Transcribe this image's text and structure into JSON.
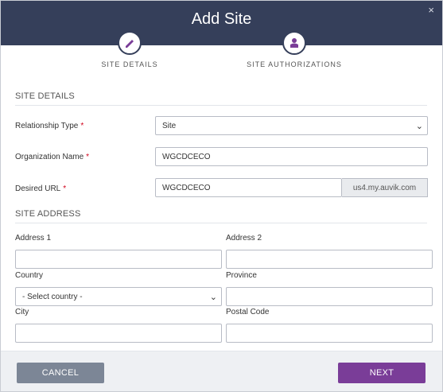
{
  "dialog": {
    "title": "Add Site",
    "close_label": "×"
  },
  "steps": [
    {
      "label": "SITE DETAILS",
      "icon": "pencil-icon"
    },
    {
      "label": "SITE AUTHORIZATIONS",
      "icon": "user-lock-icon"
    }
  ],
  "site_details": {
    "section_title": "SITE DETAILS",
    "relationship_type": {
      "label": "Relationship Type",
      "required_mark": "*",
      "value": "Site"
    },
    "organization_name": {
      "label": "Organization Name",
      "required_mark": "*",
      "value": "WGCDCECO"
    },
    "desired_url": {
      "label": "Desired URL",
      "required_mark": "*",
      "value": "WGCDCECO",
      "suffix": "us4.my.auvik.com"
    }
  },
  "site_address": {
    "section_title": "SITE ADDRESS",
    "address1": {
      "label": "Address 1",
      "value": ""
    },
    "address2": {
      "label": "Address 2",
      "value": ""
    },
    "country": {
      "label": "Country",
      "value": "- Select country -"
    },
    "province": {
      "label": "Province",
      "value": ""
    },
    "city": {
      "label": "City",
      "value": ""
    },
    "postal_code": {
      "label": "Postal Code",
      "value": ""
    }
  },
  "footer": {
    "cancel_label": "CANCEL",
    "next_label": "NEXT"
  },
  "colors": {
    "header": "#353f5a",
    "primary": "#7a3d98",
    "secondary": "#7c8696",
    "required": "#d0021b"
  }
}
